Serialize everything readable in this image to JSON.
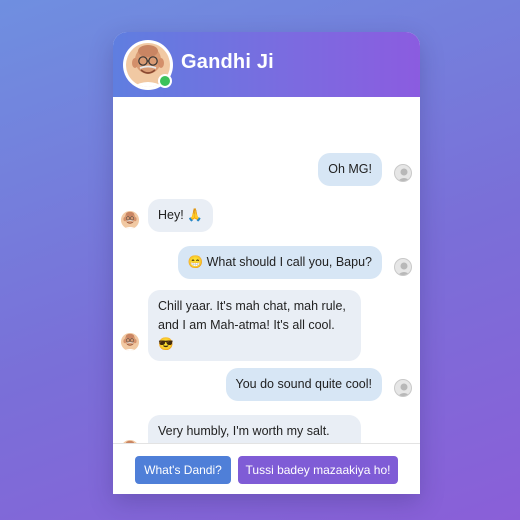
{
  "header": {
    "name": "Gandhi Ji",
    "avatar_icon": "gandhi-avatar-icon",
    "status_color": "#3cc15a"
  },
  "messages": [
    {
      "from": "user",
      "text": "Oh MG!"
    },
    {
      "from": "bot",
      "text": "Hey! 🙏"
    },
    {
      "from": "user",
      "text": "😁 What should I call you, Bapu?"
    },
    {
      "from": "bot",
      "text": "Chill yaar. It's mah chat, mah rule,\nand I am Mah-atma! It's all cool.\n😎"
    },
    {
      "from": "user",
      "text": "You do sound quite cool!"
    },
    {
      "from": "bot",
      "text": "Very humbly, I'm worth my salt.\n#DandiBaat"
    }
  ],
  "quick_replies": [
    {
      "label": "What's Dandi?",
      "color": "#4f7fd8"
    },
    {
      "label": "Tussi badey mazaakiya ho!",
      "color": "#7f5cd6"
    }
  ],
  "colors": {
    "header_start": "#5f7ee0",
    "header_end": "#8b5ce0",
    "bubble_bot": "#e9eef5",
    "bubble_user": "#d7e6f5"
  }
}
